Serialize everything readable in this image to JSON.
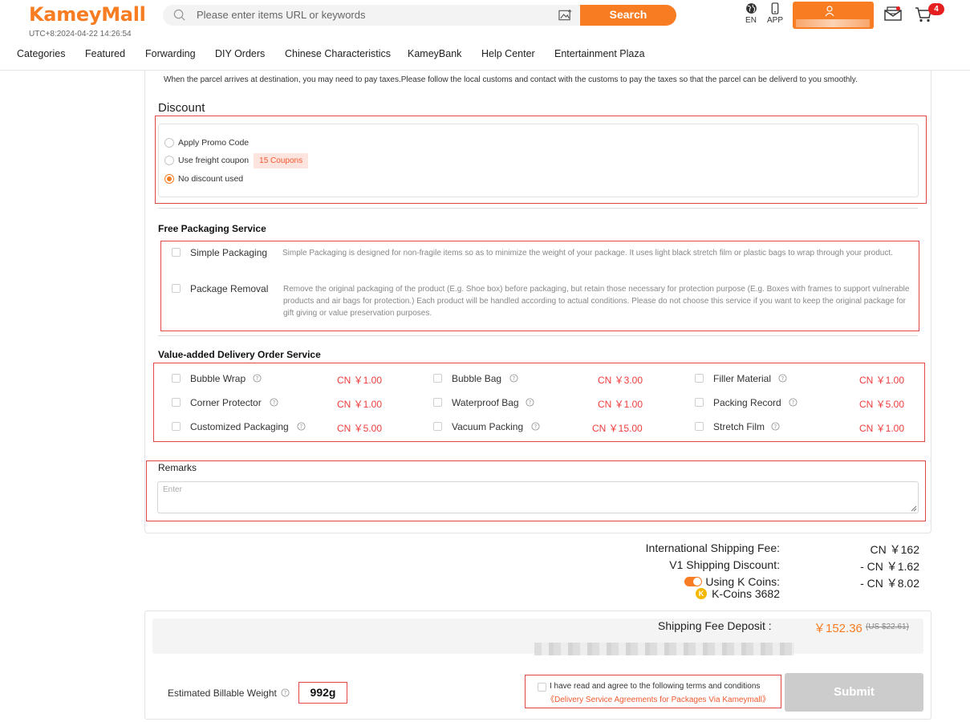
{
  "header": {
    "logo": "KameyMall",
    "clock": "UTC+8:2024-04-22 14:26:54",
    "search_placeholder": "Please enter items URL or keywords",
    "search_button": "Search",
    "lang": "EN",
    "app": "APP",
    "cart_count": "4"
  },
  "nav": [
    "Categories",
    "Featured",
    "Forwarding",
    "DIY Orders",
    "Chinese Characteristics",
    "KameyBank",
    "Help Center",
    "Entertainment Plaza"
  ],
  "tax_note": "When the parcel arrives at destination, you may need to pay taxes.Please follow the local customs and contact with the customs to pay the taxes so that the parcel can be deliverd to you smoothly.",
  "discount": {
    "title": "Discount",
    "options": [
      {
        "label": "Apply Promo Code",
        "selected": false
      },
      {
        "label": "Use freight coupon",
        "selected": false,
        "tag": "15 Coupons"
      },
      {
        "label": "No discount used",
        "selected": true
      }
    ]
  },
  "free_packaging": {
    "title": "Free Packaging Service",
    "items": [
      {
        "label": "Simple Packaging",
        "desc": "Simple Packaging is designed for non-fragile items so as to minimize the weight of your package. It uses light black stretch film or plastic bags to wrap through your product."
      },
      {
        "label": "Package Removal",
        "desc": "Remove the original packaging of the product (E.g. Shoe box) before packaging, but retain those necessary for protection purpose (E.g. Boxes with frames to support vulnerable products and air bags for protection.) Each product will be handled according to actual conditions. Please do not choose this service if you want to keep the original package for gift giving or value preservation purposes."
      }
    ]
  },
  "value_added": {
    "title": "Value-added Delivery Order Service",
    "items": [
      {
        "label": "Bubble Wrap",
        "price": "CN ￥1.00"
      },
      {
        "label": "Bubble Bag",
        "price": "CN ￥3.00"
      },
      {
        "label": "Filler Material",
        "price": "CN ￥1.00"
      },
      {
        "label": "Corner Protector",
        "price": "CN ￥1.00"
      },
      {
        "label": "Waterproof Bag",
        "price": "CN ￥1.00"
      },
      {
        "label": "Packing Record",
        "price": "CN ￥5.00"
      },
      {
        "label": "Customized Packaging",
        "price": "CN ￥5.00"
      },
      {
        "label": "Vacuum Packing",
        "price": "CN ￥15.00"
      },
      {
        "label": "Stretch Film",
        "price": "CN ￥1.00"
      }
    ]
  },
  "remarks": {
    "title": "Remarks",
    "placeholder": "Enter"
  },
  "fees": {
    "intl_label": "International Shipping Fee:",
    "intl_value": "CN ￥162",
    "discount_label": "V1 Shipping Discount:",
    "discount_value": "- CN ￥1.62",
    "coins_label": "Using K Coins:",
    "coins_value": "- CN ￥8.02",
    "coins_balance": "K-Coins 3682",
    "coins_enabled": true
  },
  "deposit": {
    "label": "Shipping Fee Deposit :",
    "value": "￥152.36",
    "usd": "(US $22.61)"
  },
  "weight": {
    "label": "Estimated Billable Weight",
    "value": "992g"
  },
  "terms": {
    "text": "I have read and agree to the following terms and conditions",
    "link": "《Delivery Service Agreements for Packages Via Kameymall》"
  },
  "submit": "Submit",
  "colors": {
    "accent": "#f77c22",
    "price": "#ef3c3c",
    "highlight_border": "#e04848"
  }
}
